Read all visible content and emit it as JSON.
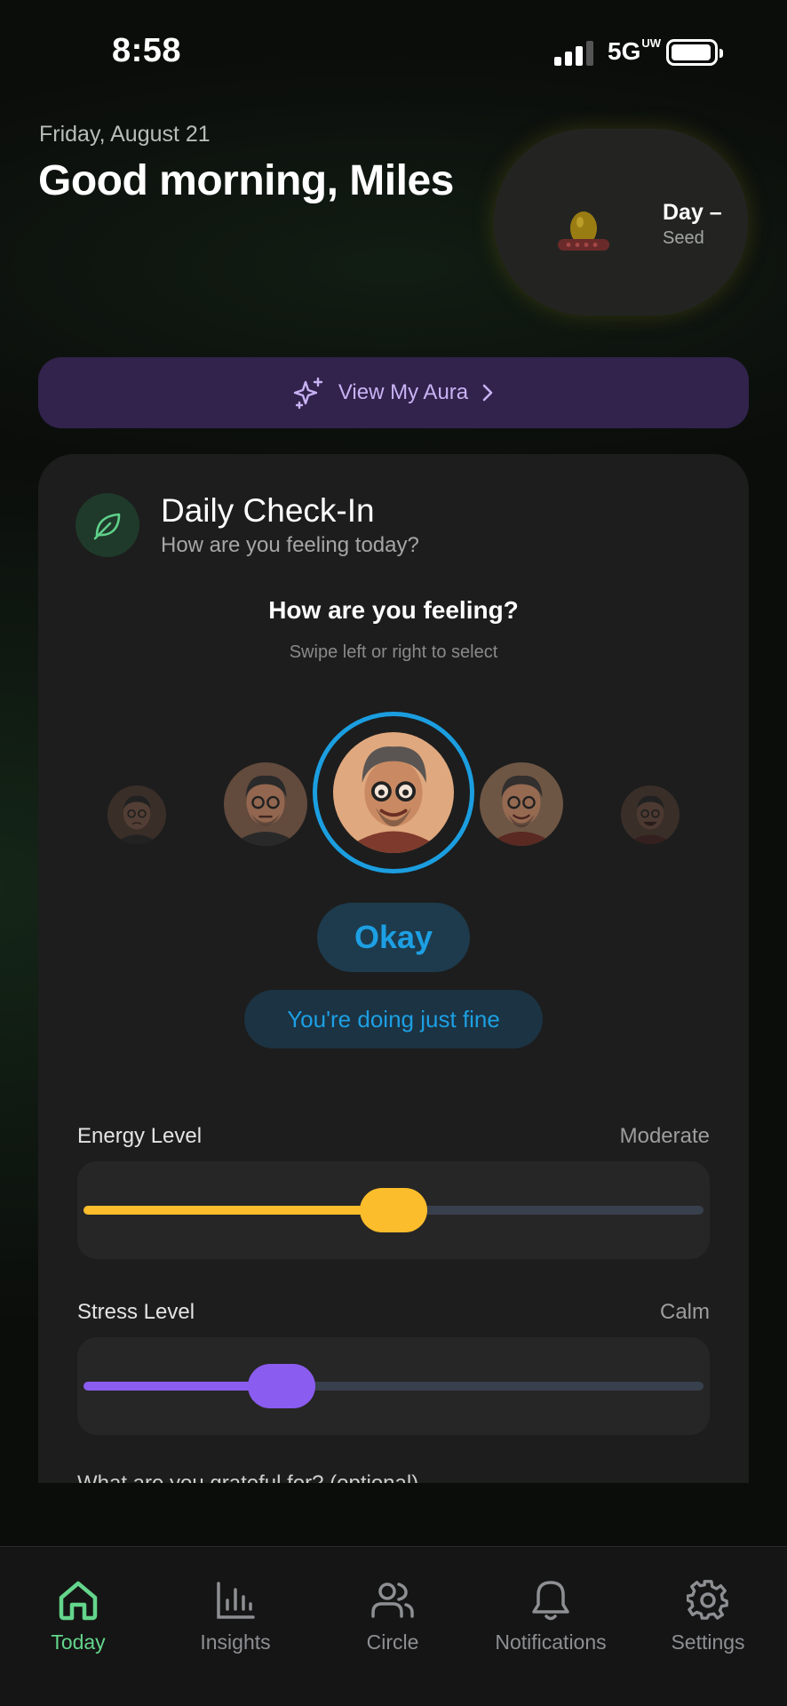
{
  "status_bar": {
    "time": "8:58",
    "network": "5G",
    "network_sup": "UW",
    "signal_bars": 3
  },
  "header": {
    "date": "Friday, August 21",
    "greeting": "Good morning, Miles",
    "day_label": "Day –",
    "stage_label": "Seed"
  },
  "aura_button": {
    "label": "View My Aura",
    "icon": "sparkles-icon",
    "color": "#c9b2f4"
  },
  "checkin": {
    "title": "Daily Check-In",
    "subtitle": "How are you feeling today?",
    "question": "How are you feeling?",
    "hint": "Swipe left or right to select",
    "selected_mood": "Okay",
    "mood_message": "You're doing just fine",
    "accent_color": "#1d9fe3",
    "moods_visible": 5,
    "selected_index": 2
  },
  "sliders": {
    "energy": {
      "label": "Energy Level",
      "value_label": "Moderate",
      "value": 0.5,
      "color": "#fbbd2c"
    },
    "stress": {
      "label": "Stress Level",
      "value_label": "Calm",
      "value": 0.32,
      "color": "#8b5cf0"
    }
  },
  "cut_off_text": "What are you grateful for? (optional)",
  "tabs": [
    {
      "label": "Today",
      "icon": "home-icon",
      "active": true
    },
    {
      "label": "Insights",
      "icon": "bar-chart-icon",
      "active": false
    },
    {
      "label": "Circle",
      "icon": "people-icon",
      "active": false
    },
    {
      "label": "Notifications",
      "icon": "bell-icon",
      "active": false
    },
    {
      "label": "Settings",
      "icon": "gear-icon",
      "active": false
    }
  ],
  "colors": {
    "active_tab": "#64d58c",
    "inactive_tab": "#8d8f93"
  }
}
